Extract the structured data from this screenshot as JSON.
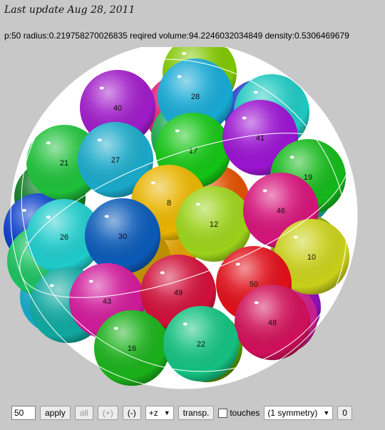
{
  "header": {
    "last_update": "Last update Aug 28, 2011"
  },
  "stats": {
    "text": "p:50 radius:0.219758270026835 reqired volume:94.2246032034849 density:0.5306469679"
  },
  "scene": {
    "balls": [
      {
        "label": "",
        "color": "#7fc600"
      },
      {
        "label": "",
        "color": "#e01770"
      },
      {
        "label": "",
        "color": "#1a2fc8"
      },
      {
        "label": "",
        "color": "#1faa50"
      },
      {
        "label": "",
        "color": "#13b9b0"
      },
      {
        "label": "",
        "color": "#0a7a20"
      },
      {
        "label": "",
        "color": "#0a3ec8"
      },
      {
        "label": "",
        "color": "#8c0fb5"
      },
      {
        "label": "",
        "color": "#15a8c8"
      },
      {
        "label": "",
        "color": "#e0a000"
      },
      {
        "label": "",
        "color": "#e05000"
      },
      {
        "label": "",
        "color": "#c01040"
      },
      {
        "label": "",
        "color": "#8aa800"
      },
      {
        "label": "",
        "color": "#c82090"
      },
      {
        "label": "",
        "color": "#1cc060"
      },
      {
        "label": "",
        "color": "#0a7a20"
      },
      {
        "label": "",
        "color": "#a01080"
      },
      {
        "label": "",
        "color": "#5a9a00"
      },
      {
        "label": "",
        "color": "#c09000"
      },
      {
        "label": "28",
        "color": "#17a9d4"
      },
      {
        "label": "40",
        "color": "#9f1bc8"
      },
      {
        "label": "",
        "color": "#1fc8c0"
      },
      {
        "label": "21",
        "color": "#1fbf3a"
      },
      {
        "label": "27",
        "color": "#1aa9c9"
      },
      {
        "label": "17",
        "color": "#14c414"
      },
      {
        "label": "41",
        "color": "#9a14d0"
      },
      {
        "label": "19",
        "color": "#14b81a"
      },
      {
        "label": "8",
        "color": "#e9b400"
      },
      {
        "label": "26",
        "color": "#1fcbcb"
      },
      {
        "label": "30",
        "color": "#0a5ab8"
      },
      {
        "label": "12",
        "color": "#9bd21a"
      },
      {
        "label": "46",
        "color": "#d5147a"
      },
      {
        "label": "10",
        "color": "#c9d01a"
      },
      {
        "label": "",
        "color": "#10a8a0"
      },
      {
        "label": "43",
        "color": "#d01a9a"
      },
      {
        "label": "49",
        "color": "#d0103a"
      },
      {
        "label": "50",
        "color": "#e0101a"
      },
      {
        "label": "48",
        "color": "#d0105a"
      },
      {
        "label": "16",
        "color": "#1ab01a"
      },
      {
        "label": "22",
        "color": "#14c080"
      }
    ]
  },
  "controls": {
    "count_value": "50",
    "apply_label": "apply",
    "all_label": "all",
    "plus_label": "(+)",
    "minus_label": "(-)",
    "axis_value": "+z",
    "transp_label": "transp.",
    "touches_label": "touches",
    "symmetry_value": "(1 symmetry)",
    "zero_label": "0"
  }
}
